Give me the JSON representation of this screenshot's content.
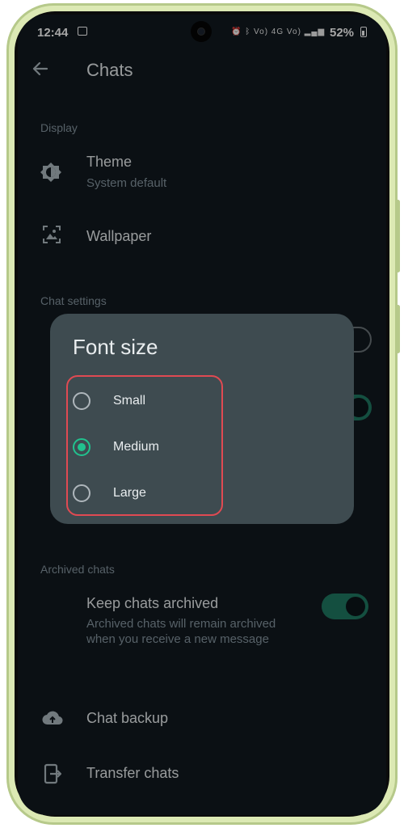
{
  "status_bar": {
    "time": "12:44",
    "indicators": "Vo) 4G Vo)",
    "battery": "52%"
  },
  "header": {
    "title": "Chats"
  },
  "display": {
    "section_label": "Display",
    "theme_title": "Theme",
    "theme_value": "System default",
    "wallpaper_title": "Wallpaper"
  },
  "chat_settings": {
    "section_label": "Chat settings"
  },
  "font_dialog": {
    "title": "Font size",
    "options": [
      {
        "label": "Small",
        "selected": false
      },
      {
        "label": "Medium",
        "selected": true
      },
      {
        "label": "Large",
        "selected": false
      }
    ],
    "accent_color": "#21c28e",
    "highlight_color": "#e04a52"
  },
  "archived": {
    "section_label": "Archived chats",
    "keep_title": "Keep chats archived",
    "keep_desc": "Archived chats will remain archived when you receive a new message",
    "keep_enabled": true
  },
  "more": {
    "backup_title": "Chat backup",
    "transfer_title": "Transfer chats"
  },
  "icons": {
    "back": "arrow-left-icon",
    "theme": "brightness-icon",
    "wallpaper": "wallpaper-icon",
    "backup": "cloud-upload-icon",
    "transfer": "transfer-icon"
  }
}
